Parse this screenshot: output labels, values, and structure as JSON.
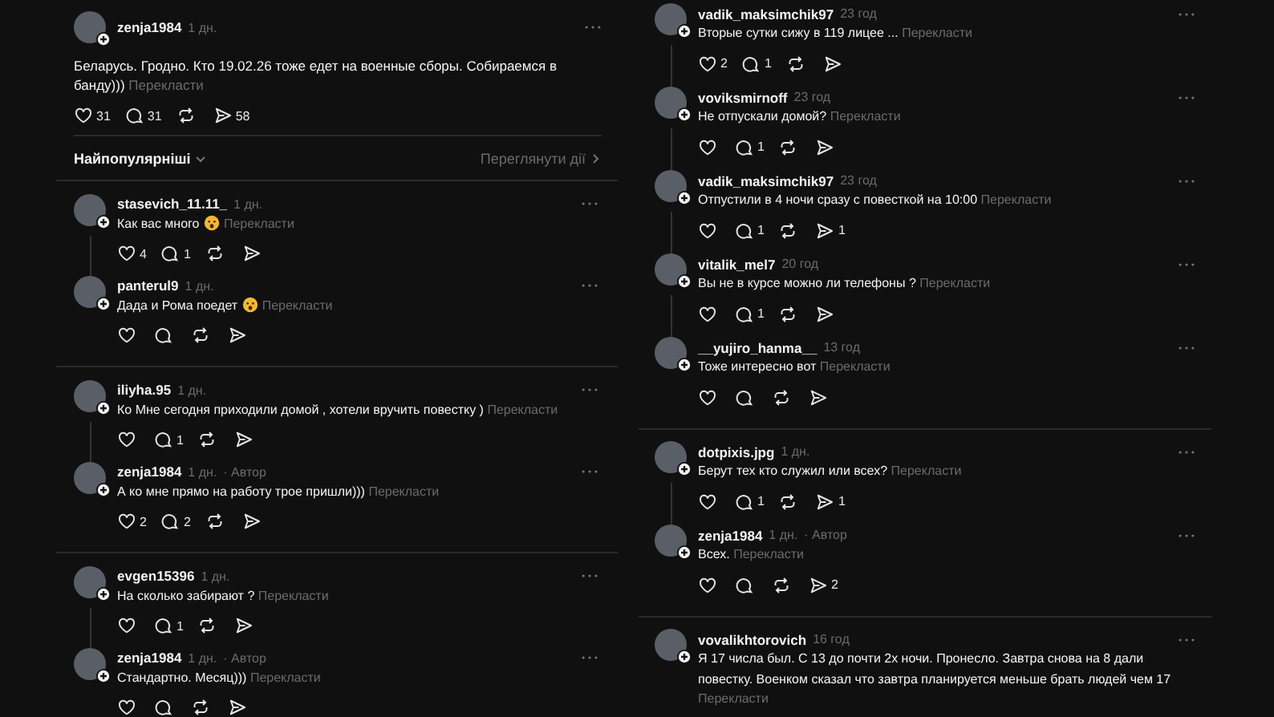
{
  "post": {
    "username": "zenja1984",
    "time": "1 дн.",
    "text": "Беларусь. Гродно. Кто 19.02.26 тоже едет на военные сборы. Собираемся в банду)))",
    "translate": "Перекласти",
    "likes": "31",
    "replies": "31",
    "shares": "58"
  },
  "sort": {
    "label": "Найпопулярніші",
    "activity_link": "Переглянути дії"
  },
  "columns": [
    {
      "threads": [
        {
          "comments": [
            {
              "username": "stasevich_11.11_",
              "time": "1 дн.",
              "text": "Как вас много",
              "emoji": true,
              "translate": "Перекласти",
              "likes": "4",
              "replies": "1",
              "actions_visible": true
            },
            {
              "username": "panterul9",
              "time": "1 дн.",
              "text": "Дада и Рома поедет",
              "emoji": true,
              "translate": "Перекласти",
              "actions_visible": true
            }
          ]
        },
        {
          "comments": [
            {
              "username": "iliyha.95",
              "time": "1 дн.",
              "text": "Ко Мне сегодня приходили домой , хотели вручить повестку )",
              "translate": "Перекласти",
              "replies": "1",
              "actions_visible": true
            },
            {
              "username": "zenja1984",
              "time": "1 дн.",
              "author": "· Автор",
              "text": "А ко мне прямо на работу трое пришли)))",
              "translate": "Перекласти",
              "likes": "2",
              "replies": "2",
              "actions_visible": true
            }
          ]
        },
        {
          "comments": [
            {
              "username": "evgen15396",
              "time": "1 дн.",
              "text": "На сколько забирают ?",
              "translate": "Перекласти",
              "replies": "1",
              "actions_visible": true
            },
            {
              "username": "zenja1984",
              "time": "1 дн.",
              "author": "· Автор",
              "text": "Стандартно. Месяц)))",
              "translate": "Перекласти",
              "actions_visible": true
            }
          ]
        }
      ]
    },
    {
      "threads": [
        {
          "comments": [
            {
              "username": "vadik_maksimchik97",
              "time": "23 год",
              "text": "Вторые сутки сижу в 119 лицее ...",
              "translate": "Перекласти",
              "likes": "2",
              "replies": "1",
              "actions_visible": true
            },
            {
              "username": "voviksmirnoff",
              "time": "23 год",
              "text": "Не отпускали домой?",
              "translate": "Перекласти",
              "replies": "1",
              "actions_visible": true
            },
            {
              "username": "vadik_maksimchik97",
              "time": "23 год",
              "text": "Отпустили в 4 ночи сразу с повесткой на 10:00",
              "translate": "Перекласти",
              "replies": "1",
              "shares": "1",
              "actions_visible": true
            },
            {
              "username": "vitalik_mel7",
              "time": "20 год",
              "text": "Вы не в курсе можно ли телефоны ?",
              "translate": "Перекласти",
              "replies": "1",
              "actions_visible": true
            },
            {
              "username": "__yujiro_hanma__",
              "time": "13 год",
              "text": "Тоже интересно вот",
              "translate": "Перекласти",
              "actions_visible": true
            }
          ]
        },
        {
          "comments": [
            {
              "username": "dotpixis.jpg",
              "time": "1 дн.",
              "text": "Берут тех кто служил или всех?",
              "translate": "Перекласти",
              "replies": "1",
              "shares": "1",
              "actions_visible": true
            },
            {
              "username": "zenja1984",
              "time": "1 дн.",
              "author": "· Автор",
              "text": "Всех.",
              "translate": "Перекласти",
              "shares": "2",
              "actions_visible": true
            }
          ]
        },
        {
          "comments": [
            {
              "username": "vovalikhtorovich",
              "time": "16 год",
              "text": "Я 17 числа был. С 13 до почти 2х ночи. Пронесло. Завтра снова на 8 дали повестку. Военком сказал что завтра планируется меньше брать людей чем 17",
              "translate": "Перекласти",
              "actions_visible": false
            }
          ]
        }
      ]
    }
  ]
}
